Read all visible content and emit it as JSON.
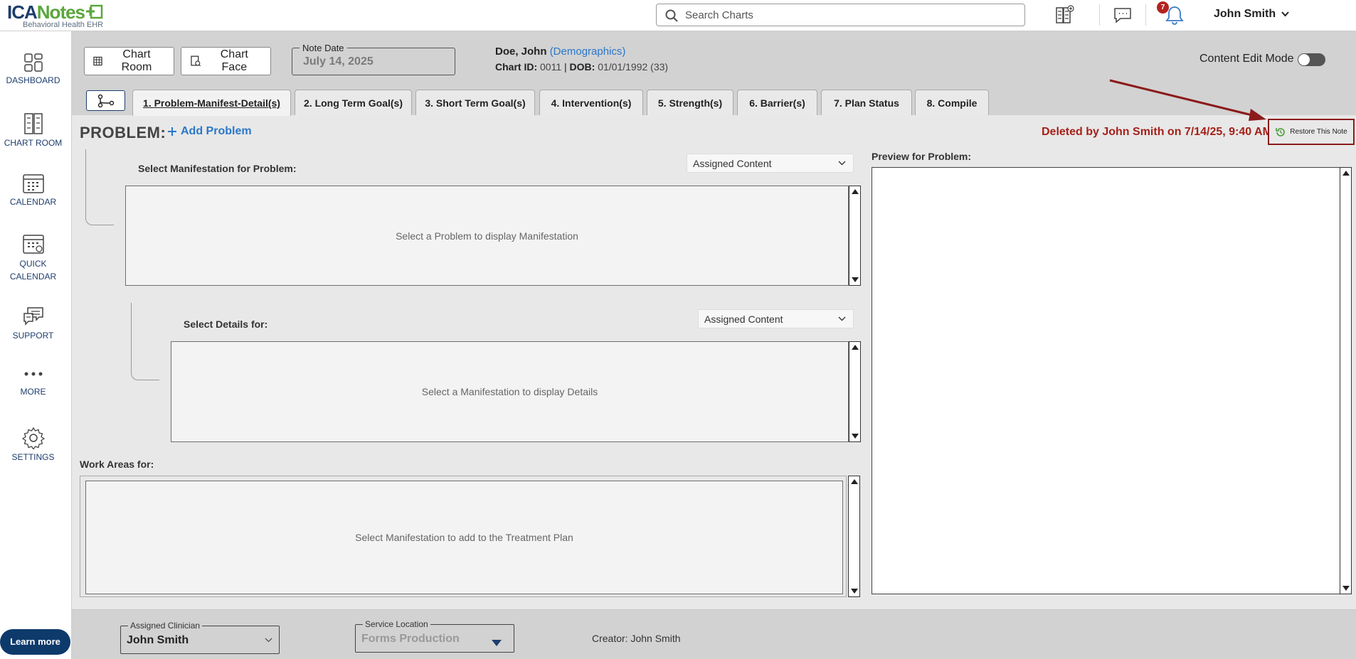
{
  "app": {
    "logo_main_a": "ICA",
    "logo_main_b": "Notes",
    "logo_sub": "Behavioral Health EHR"
  },
  "topbar": {
    "search_placeholder": "Search Charts",
    "notification_count": "7",
    "user_name": "John Smith"
  },
  "sidebar": {
    "items": [
      {
        "label": "DASHBOARD",
        "icon": "dashboard-icon"
      },
      {
        "label": "CHART ROOM",
        "icon": "chart-room-icon"
      },
      {
        "label": "CALENDAR",
        "icon": "calendar-icon"
      },
      {
        "label": "QUICK CALENDAR",
        "icon": "quick-calendar-icon"
      },
      {
        "label": "SUPPORT",
        "icon": "support-icon"
      },
      {
        "label": "MORE",
        "icon": "more-icon"
      },
      {
        "label": "SETTINGS",
        "icon": "settings-icon"
      }
    ],
    "learn_more": "Learn more"
  },
  "header": {
    "chart_room_label": "Chart Room",
    "chart_face_label": "Chart Face",
    "note_date_label": "Note Date",
    "note_date_value": "July 14, 2025",
    "patient_name": "Doe, John",
    "demographics_link": "(Demographics)",
    "chart_id_label": "Chart ID:",
    "chart_id_value": "0011",
    "dob_label": "DOB:",
    "dob_value": "01/01/1992 (33)",
    "content_edit_mode": "Content Edit Mode"
  },
  "tabs": [
    {
      "label": "1. Problem-Manifest-Detail(s)",
      "active": true
    },
    {
      "label": "2. Long Term Goal(s)",
      "active": false
    },
    {
      "label": "3. Short Term Goal(s)",
      "active": false
    },
    {
      "label": "4. Intervention(s)",
      "active": false
    },
    {
      "label": "5. Strength(s)",
      "active": false
    },
    {
      "label": "6. Barrier(s)",
      "active": false
    },
    {
      "label": "7. Plan Status",
      "active": false
    },
    {
      "label": "8. Compile",
      "active": false
    }
  ],
  "problem": {
    "title": "PROBLEM:",
    "add_label": "Add Problem",
    "deleted_text": "Deleted by John Smith on 7/14/25, 9:40 AM",
    "restore_label": "Restore This Note",
    "manifestation_label": "Select Manifestation for Problem:",
    "manifestation_dropdown": "Assigned Content",
    "manifestation_empty": "Select a Problem to display Manifestation",
    "details_label": "Select Details for:",
    "details_dropdown": "Assigned Content",
    "details_empty": "Select a Manifestation to display Details",
    "work_areas_label": "Work Areas for:",
    "work_areas_empty": "Select Manifestation to add to the Treatment Plan",
    "preview_label": "Preview for Problem:"
  },
  "footer": {
    "clinician_label": "Assigned Clinician",
    "clinician_value": "John Smith",
    "location_label": "Service Location",
    "location_value": "Forms Production",
    "creator": "Creator: John Smith"
  },
  "colors": {
    "brand_navy": "#1d3d6e",
    "brand_green": "#5aa73c",
    "link_blue": "#2a77c9",
    "deleted_red": "#a52019",
    "annotation_red": "#8b1a1a"
  }
}
